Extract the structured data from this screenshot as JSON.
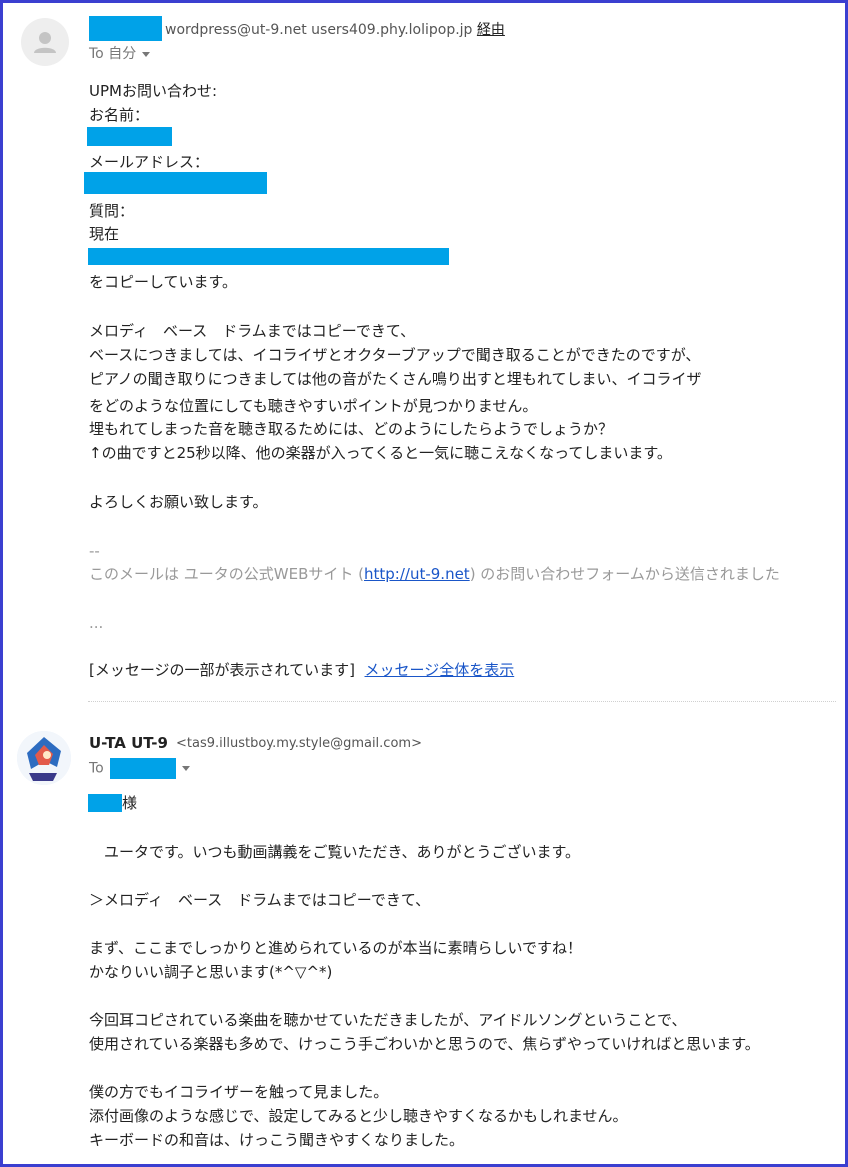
{
  "message1": {
    "sender_via": "wordpress@ut-9.net users409.phy.lolipop.jp",
    "via_label": "経由",
    "to_label": "To 自分",
    "body": {
      "title": "UPMお問い合わせ:",
      "name_label": "お名前：",
      "email_label": "メールアドレス：",
      "question_label": "質問：",
      "current": "現在",
      "copy_line": "をコピーしています。",
      "p1": "メロディ　ベース　ドラムまではコピーできて、",
      "p2": "ベースにつきましては、イコライザとオクターブアップで聞き取ることができたのですが、",
      "p3": "ピアノの聞き取りにつきましては他の音がたくさん鳴り出すと埋もれてしまい、イコライザ",
      "p4": "をどのような位置にしても聴きやすいポイントが見つかりません。",
      "p5": "埋もれてしまった音を聴き取るためには、どのようにしたらようでしょうか？",
      "p6": "↑の曲ですと25秒以降、他の楽器が入ってくると一気に聴こえなくなってしまいます。",
      "closing": "よろしくお願い致します。",
      "sig_dash": "--",
      "footer_pre": "このメールは ユータの公式WEBサイト (",
      "footer_link": "http://ut-9.net",
      "footer_post": ") のお問い合わせフォームから送信されました",
      "ellipsis": "...",
      "clipped_notice": "[メッセージの一部が表示されています]",
      "view_full": "メッセージ全体を表示"
    }
  },
  "message2": {
    "sender_name": "U-TA UT-9",
    "sender_email": "<tas9.illustboy.my.style@gmail.com>",
    "to_label": "To",
    "body": {
      "salutation": "様",
      "l1": "　ユータです。いつも動画講義をご覧いただき、ありがとうございます。",
      "l2": "＞メロディ　ベース　ドラムまではコピーできて、",
      "l3": "まず、ここまでしっかりと進められているのが本当に素晴らしいですね！",
      "l4": "かなりいい調子と思います(*^▽^*)",
      "l5": "今回耳コピされている楽曲を聴かせていただきましたが、アイドルソングということで、",
      "l6": "使用されている楽器も多めで、けっこう手ごわいかと思うので、焦らずやっていければと思います。",
      "l7": "僕の方でもイコライザーを触って見ました。",
      "l8": "添付画像のような感じで、設定してみると少し聴きやすくなるかもしれません。",
      "l9": "キーボードの和音は、けっこう聞きやすくなりました。"
    }
  },
  "colors": {
    "redaction": "#00a2e8",
    "frame": "#3b3fd0",
    "link": "#1a56c8"
  }
}
